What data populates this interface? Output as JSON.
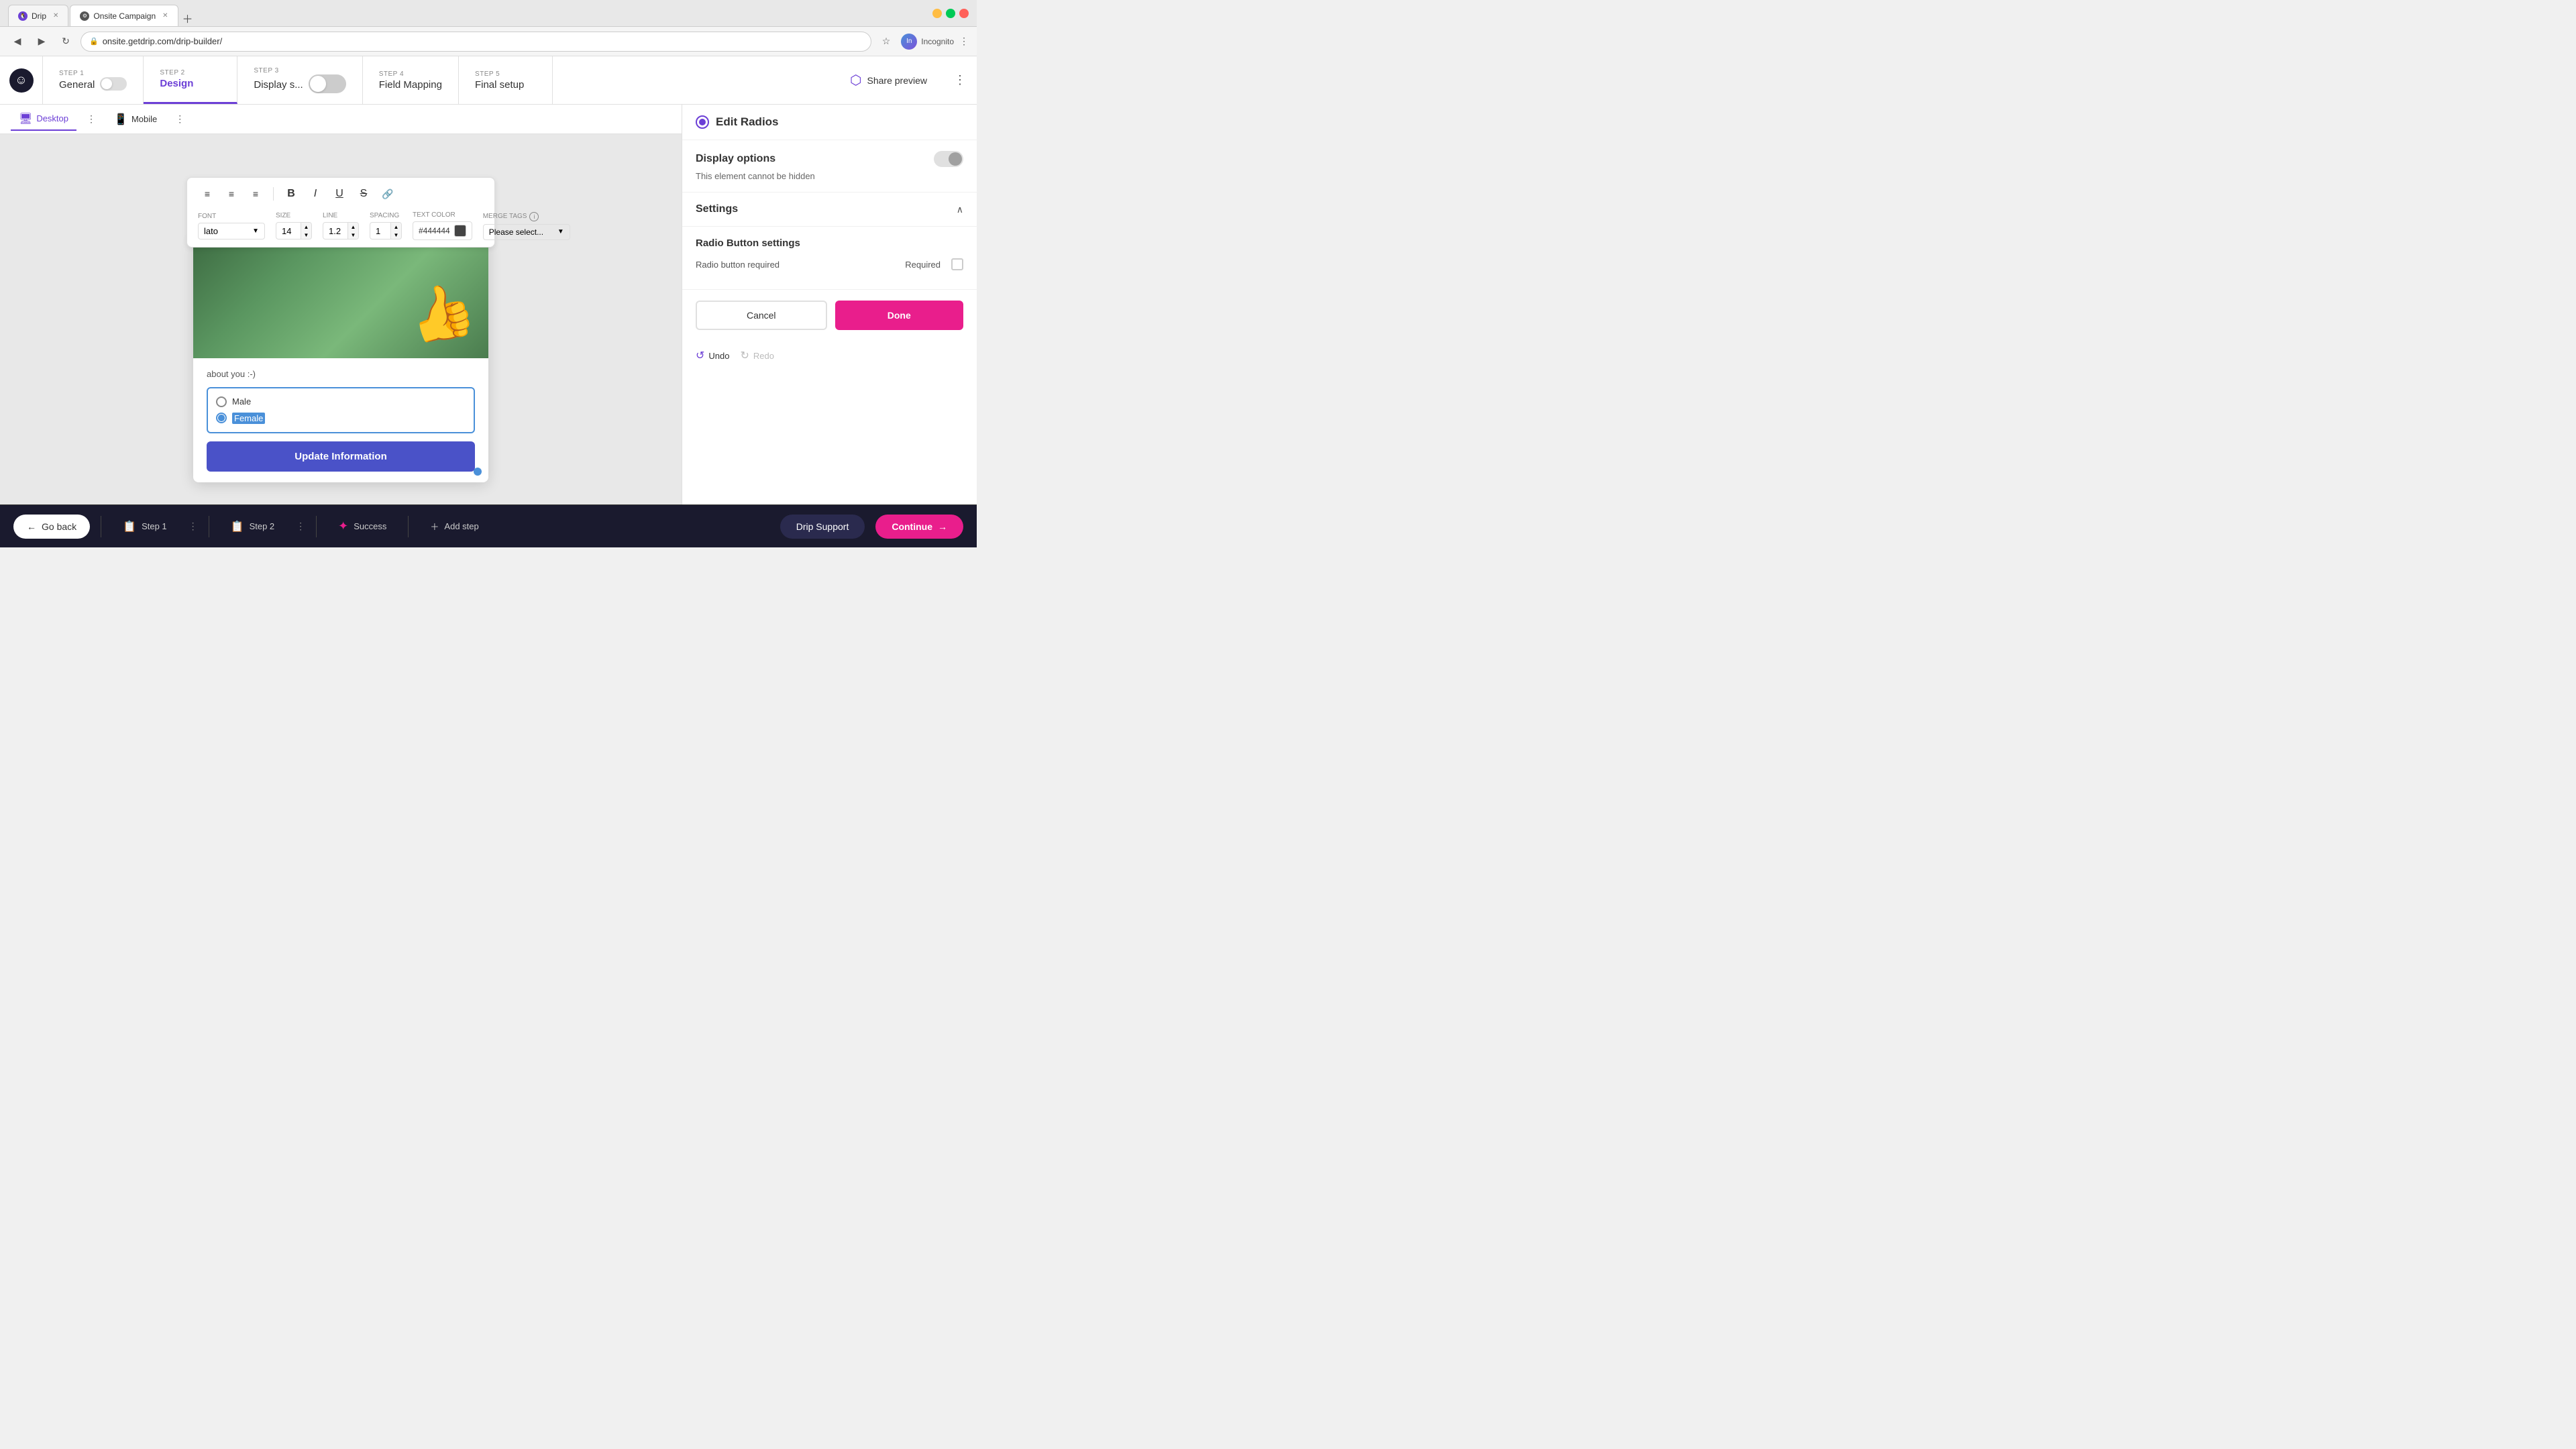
{
  "browser": {
    "tabs": [
      {
        "id": "drip",
        "label": "Drip",
        "active": false,
        "icon": "🐧"
      },
      {
        "id": "onsite",
        "label": "Onsite Campaign",
        "active": true,
        "icon": "⚙"
      }
    ],
    "url": "onsite.getdrip.com/drip-builder/",
    "incognito_label": "Incognito"
  },
  "steps": [
    {
      "id": "general",
      "number": "STEP 1",
      "label": "General",
      "has_toggle": true,
      "toggle_on": false,
      "active": false
    },
    {
      "id": "design",
      "number": "STEP 2",
      "label": "Design",
      "active": true
    },
    {
      "id": "display",
      "number": "STEP 3",
      "label": "Display s...",
      "has_display_toggle": true,
      "active": false
    },
    {
      "id": "field_mapping",
      "number": "STEP 4",
      "label": "Field Mapping",
      "active": false
    },
    {
      "id": "final_setup",
      "number": "STEP 5",
      "label": "Final setup",
      "active": false
    }
  ],
  "share_preview_label": "Share preview",
  "device_tabs": [
    {
      "id": "desktop",
      "label": "Desktop",
      "icon": "🖥",
      "active": true
    },
    {
      "id": "mobile",
      "label": "Mobile",
      "icon": "📱",
      "active": false
    }
  ],
  "text_editor": {
    "align_left": "≡",
    "align_center": "≡",
    "align_right": "≡",
    "bold": "B",
    "italic": "I",
    "underline": "U",
    "strikethrough": "S",
    "link": "🔗",
    "font_label": "Font",
    "font_value": "lato",
    "size_label": "Size",
    "size_value": "14",
    "line_label": "Line",
    "line_value": "1.2",
    "spacing_label": "Spacing",
    "spacing_value": "1",
    "text_color_label": "Text Color",
    "color_hex": "#444444",
    "merge_tags_label": "Merge Tags",
    "merge_tags_placeholder": "Please select..."
  },
  "popup": {
    "text": "about you :-)",
    "radio_options": [
      {
        "id": "male",
        "label": "Male",
        "selected": false
      },
      {
        "id": "female",
        "label": "Female",
        "selected": true,
        "editing": true
      }
    ],
    "update_button_label": "Update Information"
  },
  "right_panel": {
    "title": "Edit Radios",
    "display_options": {
      "title": "Display options",
      "description": "This element cannot be hidden"
    },
    "settings": {
      "title": "Settings"
    },
    "radio_button_settings": {
      "title": "Radio Button settings",
      "required_label": "Radio button required",
      "required_value": "Required"
    },
    "cancel_label": "Cancel",
    "done_label": "Done",
    "undo_label": "Undo",
    "redo_label": "Redo"
  },
  "bottom_bar": {
    "go_back_label": "Go back",
    "step1_label": "Step 1",
    "step2_label": "Step 2",
    "success_label": "Success",
    "add_step_label": "Add step",
    "drip_support_label": "Drip Support",
    "continue_label": "Continue"
  }
}
